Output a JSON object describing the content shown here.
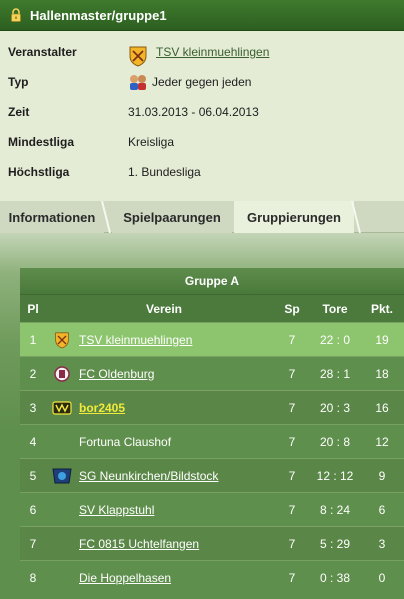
{
  "header": {
    "title": "Hallenmaster/gruppe1"
  },
  "info": {
    "veranstalter_label": "Veranstalter",
    "veranstalter_value": "TSV kleinmuehlingen",
    "typ_label": "Typ",
    "typ_value": "Jeder gegen jeden",
    "zeit_label": "Zeit",
    "zeit_value": "31.03.2013 - 06.04.2013",
    "mindestliga_label": "Mindestliga",
    "mindestliga_value": "Kreisliga",
    "hoechstliga_label": "Höchstliga",
    "hoechstliga_value": "1. Bundesliga"
  },
  "tabs": [
    {
      "label": "Informationen"
    },
    {
      "label": "Spielpaarungen"
    },
    {
      "label": "Gruppierungen"
    }
  ],
  "table": {
    "group_title": "Gruppe A",
    "headers": {
      "pl": "Pl",
      "verein": "Verein",
      "sp": "Sp",
      "tore": "Tore",
      "pkt": "Pkt."
    },
    "rows": [
      {
        "pl": "1",
        "team": "TSV kleinmuehlingen",
        "sp": "7",
        "tore": "22 : 0",
        "pkt": "19"
      },
      {
        "pl": "2",
        "team": "FC Oldenburg",
        "sp": "7",
        "tore": "28 : 1",
        "pkt": "18"
      },
      {
        "pl": "3",
        "team": "bor2405",
        "sp": "7",
        "tore": "20 : 3",
        "pkt": "16"
      },
      {
        "pl": "4",
        "team": "Fortuna Claushof",
        "sp": "7",
        "tore": "20 : 8",
        "pkt": "12"
      },
      {
        "pl": "5",
        "team": "SG Neunkirchen/Bildstock",
        "sp": "7",
        "tore": "12 : 12",
        "pkt": "9"
      },
      {
        "pl": "6",
        "team": "SV Klappstuhl",
        "sp": "7",
        "tore": "8 : 24",
        "pkt": "6"
      },
      {
        "pl": "7",
        "team": "FC 0815 Uchtelfangen",
        "sp": "7",
        "tore": "5 : 29",
        "pkt": "3"
      },
      {
        "pl": "8",
        "team": "Die Hoppelhasen",
        "sp": "7",
        "tore": "0 : 38",
        "pkt": "0"
      }
    ]
  },
  "colors": {
    "accent": "#3f7a2e",
    "highlight_row": "#8cc56d",
    "link_gold": "#f2ea3a"
  }
}
